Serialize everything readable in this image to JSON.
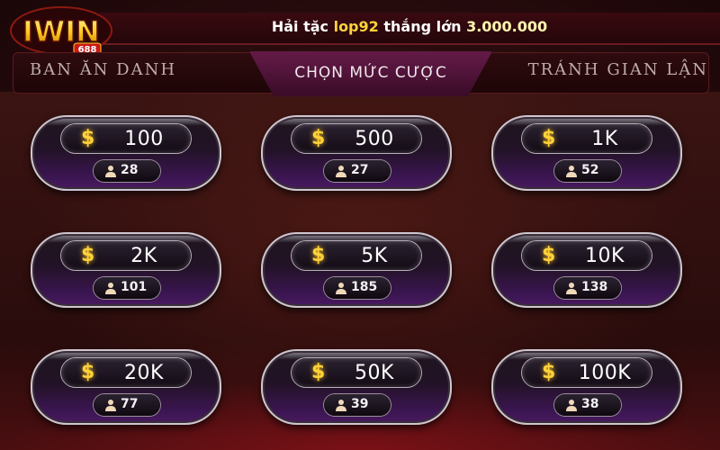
{
  "marquee": {
    "prefix": "Hải tặc",
    "user": "lop92",
    "middle": "thắng lớn",
    "amount": "3.000.000"
  },
  "logo": {
    "text": "IWIN",
    "sub": "688"
  },
  "tabs": {
    "left": "BAN ĂN DANH",
    "center": "CHỌN MỨC CƯỢC",
    "right": "TRÁNH GIAN LẬN"
  },
  "currency_symbol": "$",
  "colors": {
    "gold": "#ffd23a",
    "card_purple": "#4a1a62",
    "background": "#2b0d0e"
  },
  "bets": [
    {
      "amount": "100",
      "players": "28"
    },
    {
      "amount": "500",
      "players": "27"
    },
    {
      "amount": "1K",
      "players": "52"
    },
    {
      "amount": "2K",
      "players": "101"
    },
    {
      "amount": "5K",
      "players": "185"
    },
    {
      "amount": "10K",
      "players": "138"
    },
    {
      "amount": "20K",
      "players": "77"
    },
    {
      "amount": "50K",
      "players": "39"
    },
    {
      "amount": "100K",
      "players": "38"
    }
  ]
}
